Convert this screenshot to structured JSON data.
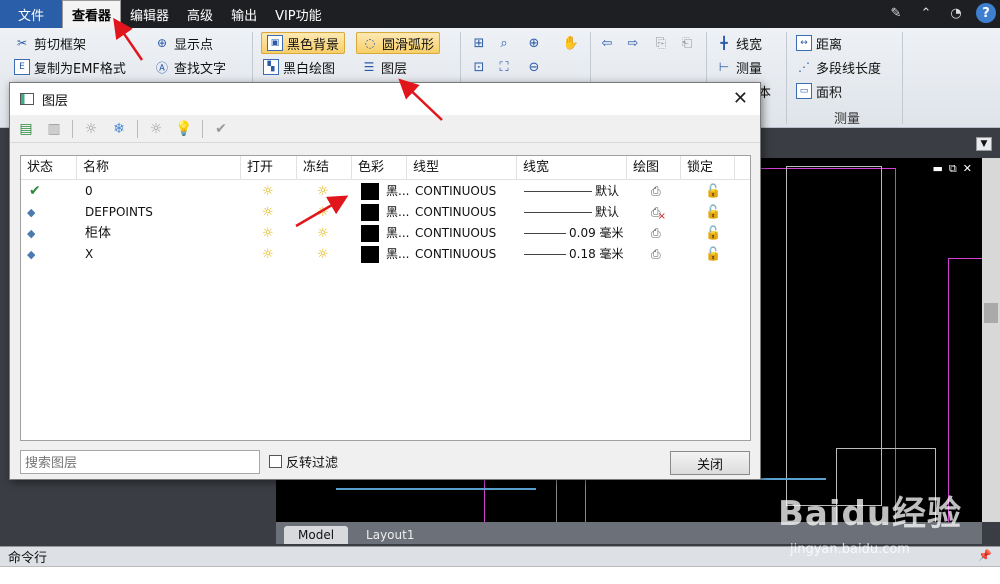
{
  "menu": {
    "items": [
      "文件",
      "查看器",
      "编辑器",
      "高级",
      "输出",
      "VIP功能"
    ],
    "active_index": 1
  },
  "ribbon": {
    "clip_frame": "剪切框架",
    "copy_emf": "复制为EMF格式",
    "show_points": "显示点",
    "find_text": "查找文字",
    "black_bg": "黑色背景",
    "smooth_arc": "圆滑弧形",
    "bw_draw": "黑白绘图",
    "layers": "图层",
    "linewidth": "线宽",
    "measure": "测量",
    "distance": "距离",
    "polyline_length": "多段线长度",
    "area": "面积",
    "measure_group": "测量",
    "ben": "本"
  },
  "dialog": {
    "title": "图层",
    "columns": [
      "状态",
      "名称",
      "打开",
      "冻结",
      "色彩",
      "线型",
      "线宽",
      "绘图",
      "锁定"
    ],
    "rows": [
      {
        "name": "0",
        "color": "黑...",
        "linetype": "CONTINUOUS",
        "linewidth": "默认",
        "current": true,
        "print": true
      },
      {
        "name": "DEFPOINTS",
        "color": "黑...",
        "linetype": "CONTINUOUS",
        "linewidth": "默认",
        "current": false,
        "print": false
      },
      {
        "name": "柜体",
        "color": "黑...",
        "linetype": "CONTINUOUS",
        "linewidth": "0.09 毫米",
        "current": false,
        "print": true
      },
      {
        "name": "X",
        "color": "黑...",
        "linetype": "CONTINUOUS",
        "linewidth": "0.18 毫米",
        "current": false,
        "print": true
      }
    ],
    "search_placeholder": "搜索图层",
    "invert_filter": "反转过滤",
    "close_label": "关闭"
  },
  "tabs": [
    "Model",
    "Layout1"
  ],
  "cmdline": {
    "label": "命令行"
  },
  "watermark": {
    "text": "Baidu经验",
    "url": "jingyan.baidu.com"
  },
  "colors": {
    "accent": "#2b5ea8",
    "arrow": "#e0161c",
    "highlight": "#f8cf68"
  }
}
